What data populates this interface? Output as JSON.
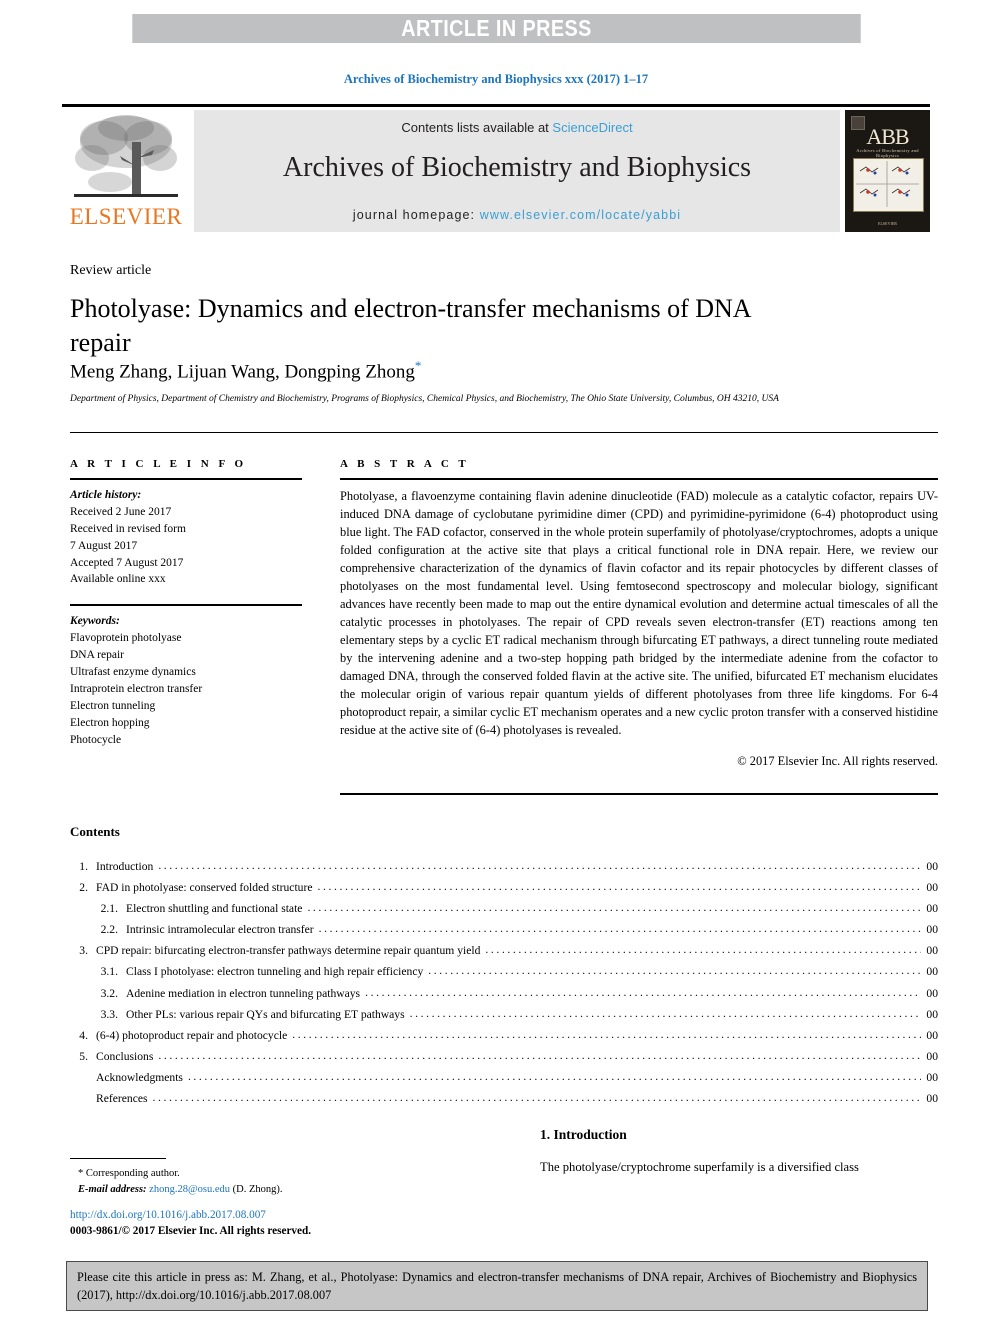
{
  "banner": {
    "text": "ARTICLE IN PRESS"
  },
  "running_head": "Archives of Biochemistry and Biophysics xxx (2017) 1–17",
  "masthead": {
    "contents_prefix": "Contents lists available at ",
    "sciencedirect": "ScienceDirect",
    "journal_title": "Archives of Biochemistry and Biophysics",
    "homepage_prefix": "journal homepage: ",
    "homepage_url": "www.elsevier.com/locate/yabbi",
    "publisher": "ELSEVIER",
    "cover": {
      "acronym": "ABB",
      "subtitle": "Archives of Biochemistry and Biophysics",
      "footer": "ELSEVIER"
    }
  },
  "article": {
    "kicker": "Review article",
    "title": "Photolyase: Dynamics and electron-transfer mechanisms of DNA repair",
    "authors": "Meng Zhang, Lijuan Wang, Dongping Zhong",
    "corresponding_marker": "*",
    "affiliation": "Department of Physics, Department of Chemistry and Biochemistry, Programs of Biophysics, Chemical Physics, and Biochemistry, The Ohio State University, Columbus, OH 43210, USA"
  },
  "article_info": {
    "heading": "A R T I C L E  I N F O",
    "history_label": "Article history:",
    "history": [
      "Received 2 June 2017",
      "Received in revised form",
      "7 August 2017",
      "Accepted 7 August 2017",
      "Available online xxx"
    ],
    "keywords_label": "Keywords:",
    "keywords": [
      "Flavoprotein photolyase",
      "DNA repair",
      "Ultrafast enzyme dynamics",
      "Intraprotein electron transfer",
      "Electron tunneling",
      "Electron hopping",
      "Photocycle"
    ]
  },
  "abstract": {
    "heading": "A B S T R A C T",
    "body": "Photolyase, a flavoenzyme containing flavin adenine dinucleotide (FAD) molecule as a catalytic cofactor, repairs UV-induced DNA damage of cyclobutane pyrimidine dimer (CPD) and pyrimidine-pyrimidone (6-4) photoproduct using blue light. The FAD cofactor, conserved in the whole protein superfamily of photolyase/cryptochromes, adopts a unique folded configuration at the active site that plays a critical functional role in DNA repair. Here, we review our comprehensive characterization of the dynamics of flavin cofactor and its repair photocycles by different classes of photolyases on the most fundamental level. Using femtosecond spectroscopy and molecular biology, significant advances have recently been made to map out the entire dynamical evolution and determine actual timescales of all the catalytic processes in photolyases. The repair of CPD reveals seven electron-transfer (ET) reactions among ten elementary steps by a cyclic ET radical mechanism through bifurcating ET pathways, a direct tunneling route mediated by the intervening adenine and a two-step hopping path bridged by the intermediate adenine from the cofactor to damaged DNA, through the conserved folded flavin at the active site. The unified, bifurcated ET mechanism elucidates the molecular origin of various repair quantum yields of different photolyases from three life kingdoms. For 6-4 photoproduct repair, a similar cyclic ET mechanism operates and a new cyclic proton transfer with a conserved histidine residue at the active site of (6-4) photolyases is revealed.",
    "copyright": "© 2017 Elsevier Inc. All rights reserved."
  },
  "contents": {
    "heading": "Contents",
    "items": [
      {
        "num": "1.",
        "level": 1,
        "label": "Introduction",
        "page": "00"
      },
      {
        "num": "2.",
        "level": 1,
        "label": "FAD in photolyase: conserved folded structure",
        "page": "00"
      },
      {
        "num": "2.1.",
        "level": 2,
        "label": "Electron shuttling and functional state",
        "page": "00"
      },
      {
        "num": "2.2.",
        "level": 2,
        "label": "Intrinsic intramolecular electron transfer",
        "page": "00"
      },
      {
        "num": "3.",
        "level": 1,
        "label": "CPD repair: bifurcating electron-transfer pathways determine repair quantum yield",
        "page": "00"
      },
      {
        "num": "3.1.",
        "level": 2,
        "label": "Class I photolyase: electron tunneling and high repair efficiency",
        "page": "00"
      },
      {
        "num": "3.2.",
        "level": 2,
        "label": "Adenine mediation in electron tunneling pathways",
        "page": "00"
      },
      {
        "num": "3.3.",
        "level": 2,
        "label": "Other PLs: various repair QYs and bifurcating ET pathways",
        "page": "00"
      },
      {
        "num": "4.",
        "level": 1,
        "label": "(6-4) photoproduct repair and photocycle",
        "page": "00"
      },
      {
        "num": "5.",
        "level": 1,
        "label": "Conclusions",
        "page": "00"
      },
      {
        "num": "",
        "level": 1,
        "label": "Acknowledgments",
        "page": "00"
      },
      {
        "num": "",
        "level": 1,
        "label": "References",
        "page": "00"
      }
    ]
  },
  "introduction": {
    "heading": "1.  Introduction",
    "first_line": "The photolyase/cryptochrome superfamily is a diversified class"
  },
  "footnote": {
    "corresponding": "* Corresponding author.",
    "email_label": "E-mail address:",
    "email": "zhong.28@osu.edu",
    "email_suffix": "(D. Zhong).",
    "doi": "http://dx.doi.org/10.1016/j.abb.2017.08.007",
    "issn": "0003-9861/© 2017 Elsevier Inc. All rights reserved."
  },
  "cite_box": {
    "text": "Please cite this article in press as: M. Zhang, et al., Photolyase: Dynamics and electron-transfer mechanisms of DNA repair, Archives of Biochemistry and Biophysics (2017), http://dx.doi.org/10.1016/j.abb.2017.08.007"
  },
  "colors": {
    "banner_bg": "#bfc0c2",
    "link_blue": "#1c75bc",
    "light_blue": "#3a9fd4",
    "elsevier_orange": "#e87722",
    "masthead_bg": "#e6e6e6",
    "cite_box_bg": "#c6c6c6"
  }
}
